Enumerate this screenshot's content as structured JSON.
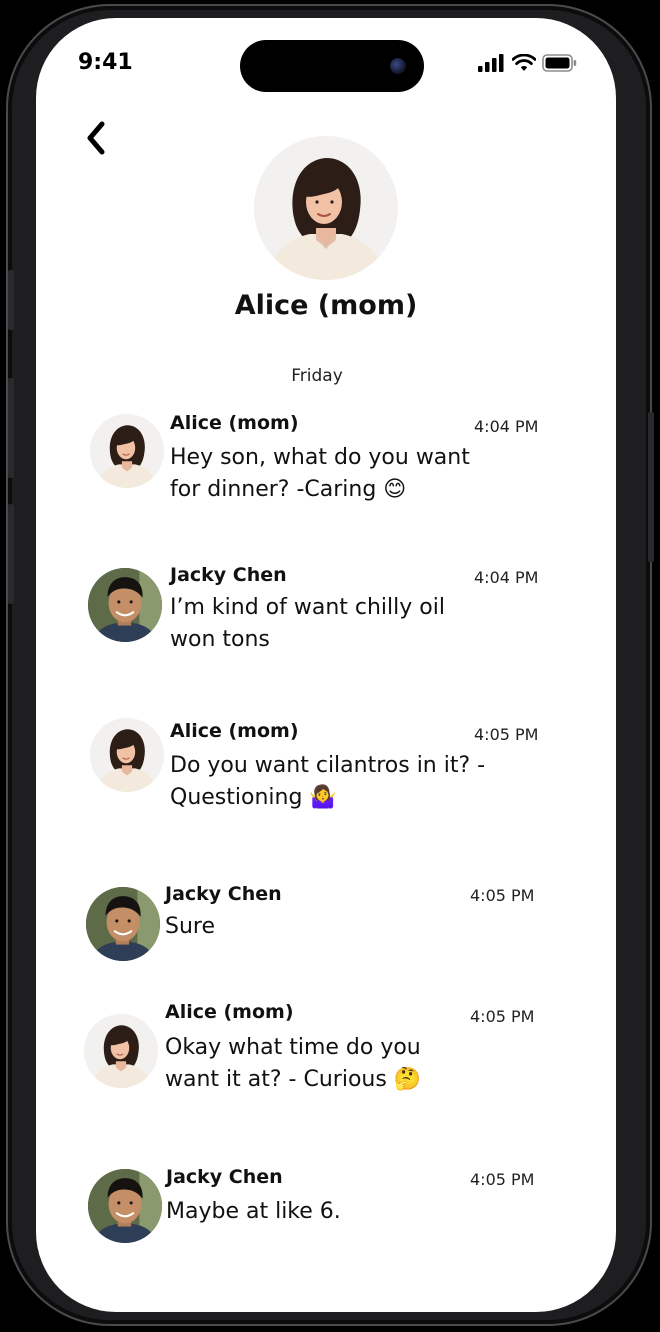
{
  "status_bar": {
    "time": "9:41"
  },
  "contact": {
    "name": "Alice (mom)"
  },
  "conversation": {
    "day_label": "Friday",
    "messages": [
      {
        "sender": "Alice (mom)",
        "time": "4:04 PM",
        "text": "Hey son, what do you want for dinner? -Caring 😊",
        "avatar": "mom-avatar"
      },
      {
        "sender": "Jacky Chen",
        "time": "4:04 PM",
        "text": "I’m kind of want chilly oil won tons",
        "avatar": "jacky-avatar"
      },
      {
        "sender": "Alice (mom)",
        "time": "4:05 PM",
        "text": "Do you want cilantros in it? - Questioning 🤷‍♀️",
        "avatar": "mom-avatar"
      },
      {
        "sender": "Jacky Chen",
        "time": "4:05 PM",
        "text": "Sure",
        "avatar": "jacky-avatar"
      },
      {
        "sender": "Alice (mom)",
        "time": "4:05 PM",
        "text": "Okay what time do you want it at? - Curious 🤔",
        "avatar": "mom-avatar"
      },
      {
        "sender": "Jacky Chen",
        "time": "4:05 PM",
        "text": "Maybe at like 6.",
        "avatar": "jacky-avatar"
      }
    ]
  }
}
